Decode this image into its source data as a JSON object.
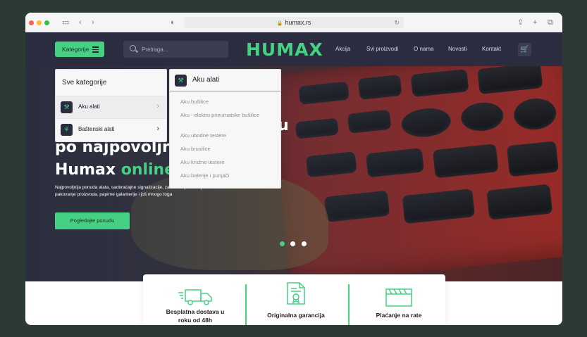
{
  "browser": {
    "url": "humax.rs"
  },
  "navbar": {
    "categories_label": "Kategorije",
    "search_placeholder": "Pretraga...",
    "logo": "HUMAX",
    "links": [
      "Akcija",
      "Svi proizvodi",
      "O nama",
      "Novosti",
      "Kontakt"
    ]
  },
  "hero": {
    "title_line1": "u",
    "title_line2": "po najpovoljni",
    "title_line3_white": "Humax ",
    "title_line3_green": "online",
    "subtitle": "Najpovoljnija ponuda alata, saobraćajne signalizacije, zaštitne opreme i proizvoda za pakovanje proizvoda, papirne galanterije i još mnogo toga",
    "cta": "Pogledajte ponudu",
    "slides": 3,
    "active_slide": 1
  },
  "dropdown": {
    "header": "Sve kategorije",
    "items": [
      {
        "label": "Aku alati",
        "icon": "drill-icon"
      },
      {
        "label": "Baštenski alati",
        "icon": "garden-tools-icon"
      }
    ]
  },
  "subpanel": {
    "header": "Aku alati",
    "links": [
      "Aku bušilice",
      "Aku - elektro pneumatske bušilice",
      "Aku ubodne testere",
      "Aku brusilice",
      "Aku kružne testere",
      "Aku baterije i punjači"
    ]
  },
  "features": [
    {
      "text": "Besplatna dostava u roku od 48h",
      "icon": "truck-icon"
    },
    {
      "text": "Originalna garancija",
      "icon": "certificate-icon"
    },
    {
      "text": "Plaćanje na rate",
      "icon": "payment-icon"
    }
  ],
  "colors": {
    "accent": "#45d083",
    "navbar_bg": "#2b2c40"
  }
}
